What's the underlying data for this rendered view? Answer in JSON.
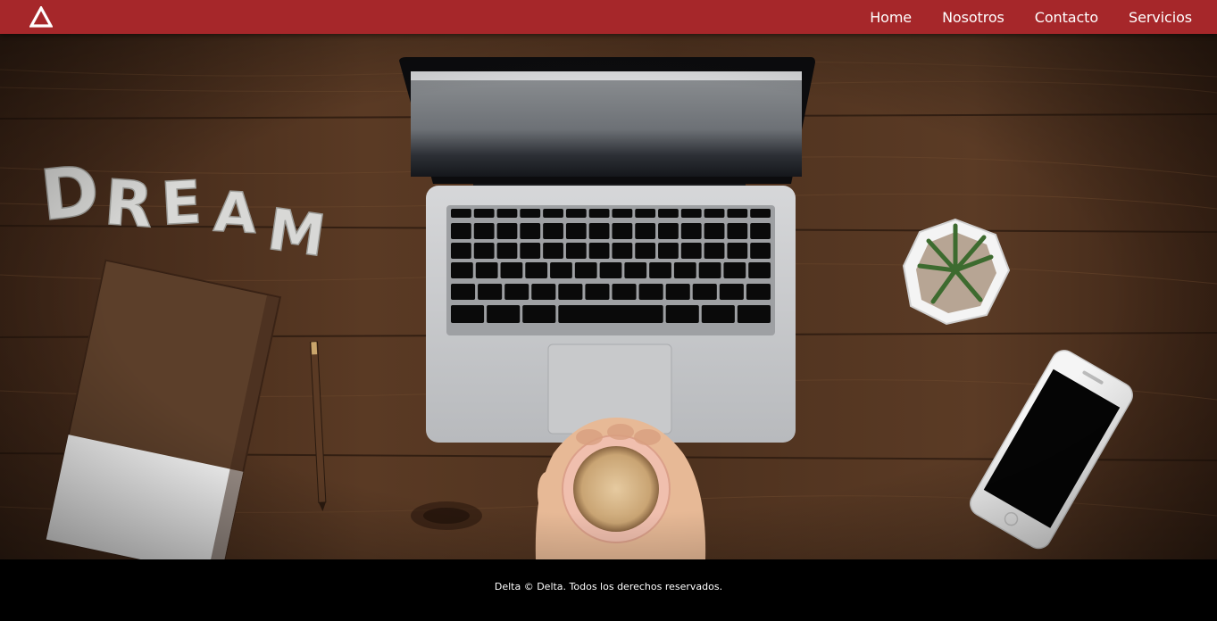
{
  "brand": {
    "logo_icon": "triangle-logo-icon"
  },
  "nav": {
    "items": [
      {
        "label": "Home"
      },
      {
        "label": "Nosotros"
      },
      {
        "label": "Contacto"
      },
      {
        "label": "Servicios"
      }
    ]
  },
  "hero": {
    "image_description_icon": "desk-photo",
    "dream_letters": [
      "D",
      "R",
      "E",
      "A",
      "M"
    ]
  },
  "footer": {
    "text": "Delta ©  Delta. Todos los derechos reservados."
  },
  "colors": {
    "header": "#a6272a",
    "footer": "#000000",
    "text": "#ffffff"
  }
}
